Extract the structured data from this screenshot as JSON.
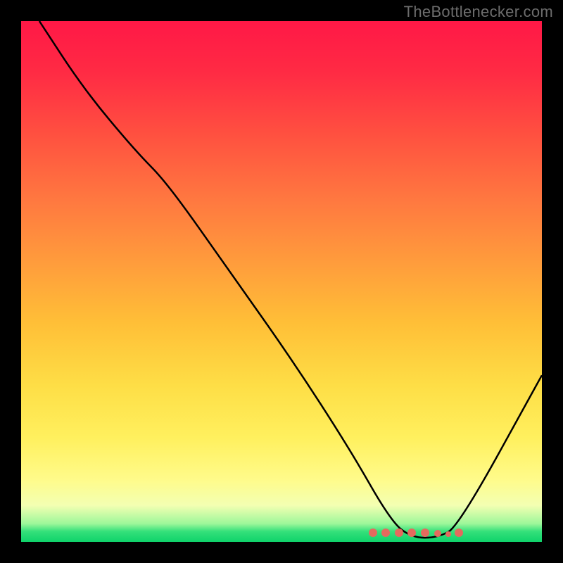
{
  "attribution": "TheBottlenecker.com",
  "chart_data": {
    "type": "line",
    "title": "",
    "xlabel": "",
    "ylabel": "",
    "xlim": [
      0,
      100
    ],
    "ylim": [
      0,
      100
    ],
    "curve": [
      {
        "x": 3.5,
        "y": 100
      },
      {
        "x": 12,
        "y": 87
      },
      {
        "x": 22,
        "y": 75
      },
      {
        "x": 28,
        "y": 69
      },
      {
        "x": 40,
        "y": 52
      },
      {
        "x": 52,
        "y": 35
      },
      {
        "x": 63,
        "y": 18
      },
      {
        "x": 71,
        "y": 4
      },
      {
        "x": 75,
        "y": 0.8
      },
      {
        "x": 80,
        "y": 0.8
      },
      {
        "x": 84,
        "y": 3
      },
      {
        "x": 100,
        "y": 32
      }
    ],
    "markers": [
      {
        "x": 67.5,
        "r": 6
      },
      {
        "x": 70.0,
        "r": 6
      },
      {
        "x": 72.5,
        "r": 6
      },
      {
        "x": 75.0,
        "r": 6
      },
      {
        "x": 77.5,
        "r": 6
      },
      {
        "x": 80.0,
        "r": 5
      },
      {
        "x": 82.0,
        "r": 4
      },
      {
        "x": 84.0,
        "r": 6
      }
    ],
    "gradient_stops": [
      {
        "pct": 0,
        "color": "#ff1846"
      },
      {
        "pct": 50,
        "color": "#ffbf37"
      },
      {
        "pct": 88,
        "color": "#fffb8a"
      },
      {
        "pct": 100,
        "color": "#0fd36b"
      }
    ]
  }
}
